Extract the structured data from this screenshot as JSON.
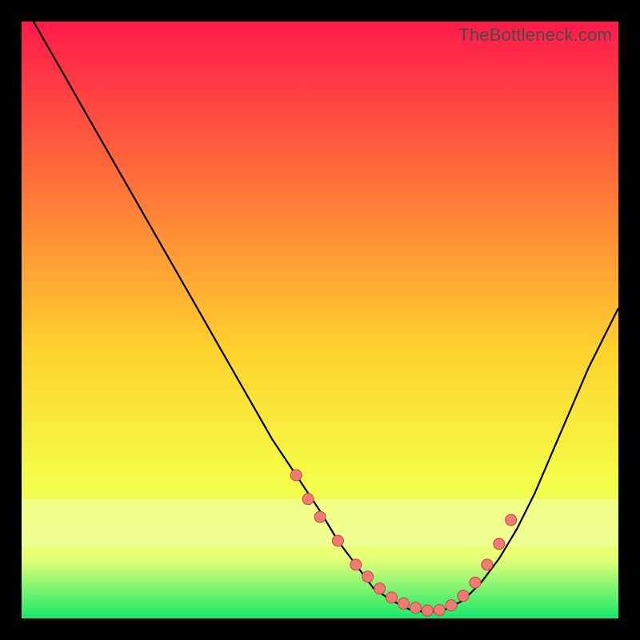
{
  "watermark": "TheBottleneck.com",
  "colors": {
    "background": "#000000",
    "grad_top": "#ff1a4b",
    "grad_mid_upper": "#ff6a3a",
    "grad_mid": "#ffd22e",
    "grad_mid_lower": "#f4ff4a",
    "grad_band_light": "#e7ff78",
    "grad_bottom": "#17e86b",
    "curve": "#000000",
    "marker_fill": "#ef7b74",
    "marker_stroke": "#c9453d"
  },
  "chart_data": {
    "type": "line",
    "title": "",
    "xlabel": "",
    "ylabel": "",
    "xlim": [
      0,
      100
    ],
    "ylim": [
      0,
      100
    ],
    "grid": false,
    "legend": false,
    "series": [
      {
        "name": "bottleneck-curve",
        "x": [
          2,
          6,
          10,
          14,
          18,
          22,
          26,
          30,
          34,
          38,
          42,
          46,
          50,
          53,
          56,
          59,
          62,
          65,
          68,
          71,
          74,
          77,
          80,
          83,
          86,
          89,
          92,
          95,
          98,
          100
        ],
        "y": [
          100,
          93,
          86,
          79,
          72,
          65,
          58,
          51,
          44,
          37,
          30,
          24,
          18,
          13,
          9,
          5,
          3,
          1.5,
          1,
          1.5,
          3,
          6,
          10,
          15,
          21,
          28,
          35,
          42,
          48,
          52
        ]
      }
    ],
    "markers": {
      "name": "sample-points",
      "x": [
        46,
        48,
        50,
        53,
        56,
        58,
        60,
        62,
        64,
        66,
        68,
        70,
        72,
        74,
        76,
        78,
        80,
        82
      ],
      "y": [
        24,
        20,
        17,
        13,
        9,
        7,
        5,
        3.5,
        2.5,
        1.8,
        1.3,
        1.4,
        2.2,
        3.8,
        6,
        9,
        12.5,
        16.5
      ]
    }
  }
}
